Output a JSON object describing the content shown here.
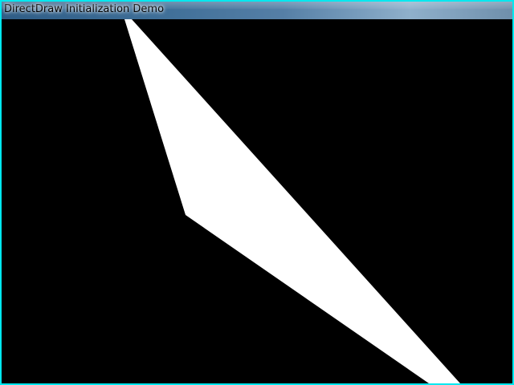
{
  "window": {
    "title": "DirectDraw Initialization Demo"
  },
  "colors": {
    "frame_border": "#00e8f0",
    "background": "#000000",
    "shape_fill": "#ffffff"
  }
}
